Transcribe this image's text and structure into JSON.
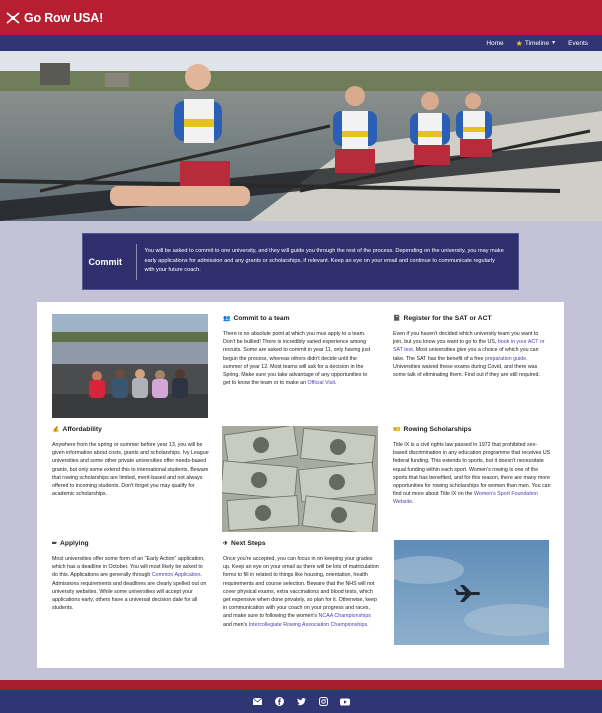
{
  "header": {
    "brand": "Go Row USA!",
    "nav": {
      "home": "Home",
      "timeline": "Timeline",
      "events": "Events"
    }
  },
  "commit": {
    "title": "Commit",
    "text": "You will be asked to commit to one university, and they will guide you through the rest of the process. Depending on the university, you may make early applications for admission and any grants or scholarships, if relevant. Keep an eye on your email and continue to communicate regularly with your future coach."
  },
  "sections": {
    "commit_team": {
      "title": "Commit to a team",
      "text": "There is no absolute point at which you mus apply to a team. Don't be bullied! There is incredibly varied experience among recruits. Some are asked to commit in year 11, only having just begun the process, whereas others didn't decide until the summer of year 12. Most teams will ask for a decision in the Spring. Make sure you take advantage of any opportunities to get to know the team or to make an ",
      "link": "Official Visit",
      "after": "."
    },
    "sat": {
      "title": "Register for the SAT or ACT",
      "text1": "Even if you haven't decided which university team you want to join, but you know you want to go to the US, ",
      "link1": "book in your ACT or SAT test",
      "text2": ". Most universities give you a choice of which you can take. The SAT has the benefit of a free ",
      "link2": "preparation guide",
      "text3": ". Universities waived these exams during Covid, and there was some talk of eliminating them. Find out if they are still required."
    },
    "affordability": {
      "title": "Affordability",
      "text": "Anywhere from the spring or summer before year 13, you will be given information about costs, grants and scholarships. Ivy League universities and some other private universities offer needs-based grants, but only some extend this to international students. Beware that rowing scholarships are limited, merit-based and not always offered to incoming students. Don't forget you may qualify for academic scholarships."
    },
    "scholarships": {
      "title": "Rowing Scholarships",
      "text": "Title IX is a civil rights law passed in 1972 that prohibited sex-based discrimination in any education programme that receives US federal funding. This extends to sports, but it doesn't necessitate equal funding within each sport. Women's rowing is one of the sports that has benefited, and for this reason, there are many more opportunities for rowing scholarships for women than men. You can find out more about Title IX on the ",
      "link": "Women's Sport Foundation Website",
      "after": "."
    },
    "applying": {
      "title": "Applying",
      "text1": "Most universities offer some form of an \"Early Action\" application, which has a deadline in October. You will most likely be asked to do this. Applications are generally through ",
      "link": "Common Application",
      "text2": ". Admissions requirements and deadlines are clearly spelled out on university websites. While some universities will accept your applications early, others have a universal decision date for all students."
    },
    "next_steps": {
      "title": "Next Steps",
      "text": "Once you're accepted, you can focus in on keeping your grades up. Keep an eye on your email as there will be lots of matriculation forms to fill in related to things like housing, orientation, health requirements and course selection. Beware that the NHS will not cover physical exams, extra vaccinations and blood tests, which get expensive when done privately, so plan for it. Otherwise, keep in communication with your coach on your progress and races, and make sure to following the women's ",
      "link1": "NCAA Championships",
      "mid": " and men's ",
      "link2": "Intercollegiate Rowing Association Championships",
      "after": "."
    }
  },
  "footer": {
    "icons": [
      "envelope-icon",
      "facebook-icon",
      "twitter-icon",
      "instagram-icon",
      "youtube-icon"
    ]
  },
  "colors": {
    "red": "#b81e32",
    "navy": "#303574",
    "link": "#4b3fae",
    "page_bg": "#c3c2d6"
  }
}
